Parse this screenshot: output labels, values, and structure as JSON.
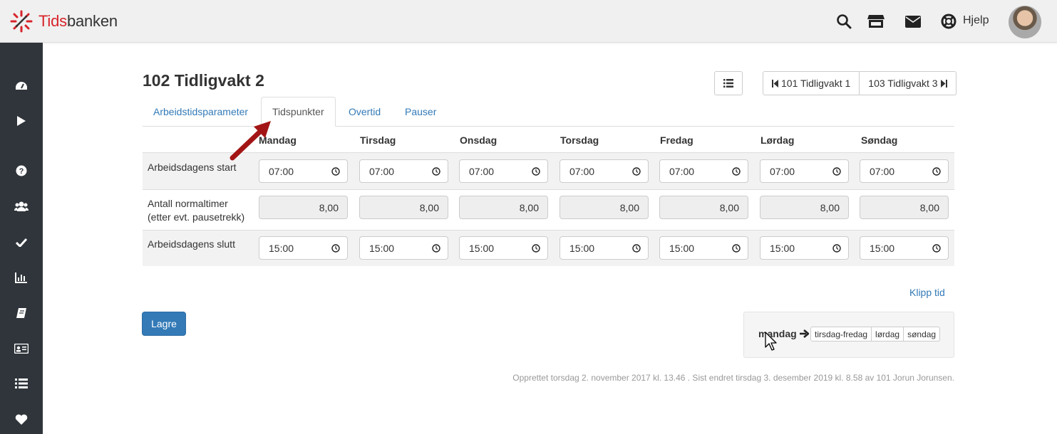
{
  "app": {
    "brand_a": "Tids",
    "brand_b": "banken"
  },
  "topbar": {
    "help_label": "Hjelp"
  },
  "page": {
    "title": "102 Tidligvakt 2"
  },
  "nav": {
    "prev_label": "101 Tidligvakt 1",
    "next_label": "103 Tidligvakt 3"
  },
  "tabs": [
    {
      "label": "Arbeidstidsparameter"
    },
    {
      "label": "Tidspunkter"
    },
    {
      "label": "Overtid"
    },
    {
      "label": "Pauser"
    }
  ],
  "days": [
    "Mandag",
    "Tirsdag",
    "Onsdag",
    "Torsdag",
    "Fredag",
    "Lørdag",
    "Søndag"
  ],
  "rows": {
    "start": {
      "label": "Arbeidsdagens start",
      "values": [
        "07:00",
        "07:00",
        "07:00",
        "07:00",
        "07:00",
        "07:00",
        "07:00"
      ]
    },
    "hours": {
      "label_line1": "Antall normaltimer",
      "label_line2": "(etter evt. pausetrekk)",
      "values": [
        "8,00",
        "8,00",
        "8,00",
        "8,00",
        "8,00",
        "8,00",
        "8,00"
      ]
    },
    "end": {
      "label": "Arbeidsdagens slutt",
      "values": [
        "15:00",
        "15:00",
        "15:00",
        "15:00",
        "15:00",
        "15:00",
        "15:00"
      ]
    }
  },
  "actions": {
    "clip_label": "Klipp tid",
    "save_label": "Lagre"
  },
  "copy": {
    "from_label": "mandag",
    "options": [
      "tirsdag-fredag",
      "lørdag",
      "søndag"
    ]
  },
  "footer": {
    "note": "Opprettet torsdag 2. november 2017 kl. 13.46 . Sist endret tirsdag 3. desember 2019 kl. 8.58 av 101 Jorun Jorunsen."
  },
  "colors": {
    "brand_red": "#d8232a",
    "link_blue": "#337ab7",
    "sidebar_bg": "#2f353b",
    "annotation_arrow": "#a31515"
  }
}
